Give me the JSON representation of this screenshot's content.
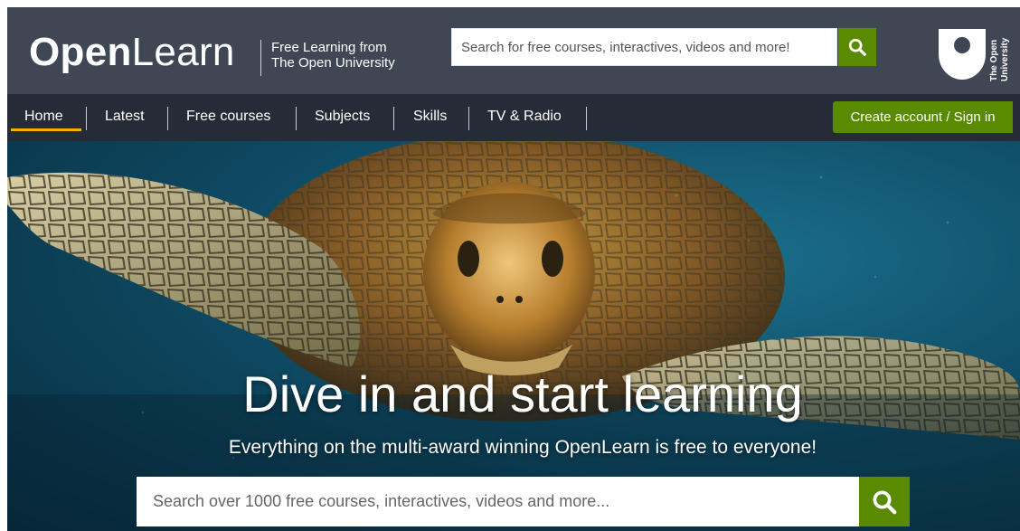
{
  "header": {
    "logo_bold": "Open",
    "logo_light": "Learn",
    "tagline_line1": "Free Learning from",
    "tagline_line2": "The Open University",
    "search_placeholder": "Search for free courses, interactives, videos and more!",
    "search_icon": "search-icon",
    "ou_logo_text_line1": "The Open",
    "ou_logo_text_line2": "University"
  },
  "nav": {
    "items": [
      {
        "label": "Home",
        "active": true
      },
      {
        "label": "Latest"
      },
      {
        "label": "Free courses"
      },
      {
        "label": "Subjects"
      },
      {
        "label": "Skills"
      },
      {
        "label": "TV & Radio"
      }
    ],
    "account_button": "Create account / Sign in"
  },
  "hero": {
    "title": "Dive in and start learning",
    "subtitle": "Everything on the multi-award winning OpenLearn is free to everyone!",
    "search_placeholder": "Search over 1000 free courses, interactives, videos and more...",
    "image_subject": "sea-turtle-photo"
  },
  "colors": {
    "header_bg": "#3f4654",
    "nav_bg": "#262c37",
    "accent_green": "#5a8a00",
    "active_underline": "#f0b400"
  }
}
